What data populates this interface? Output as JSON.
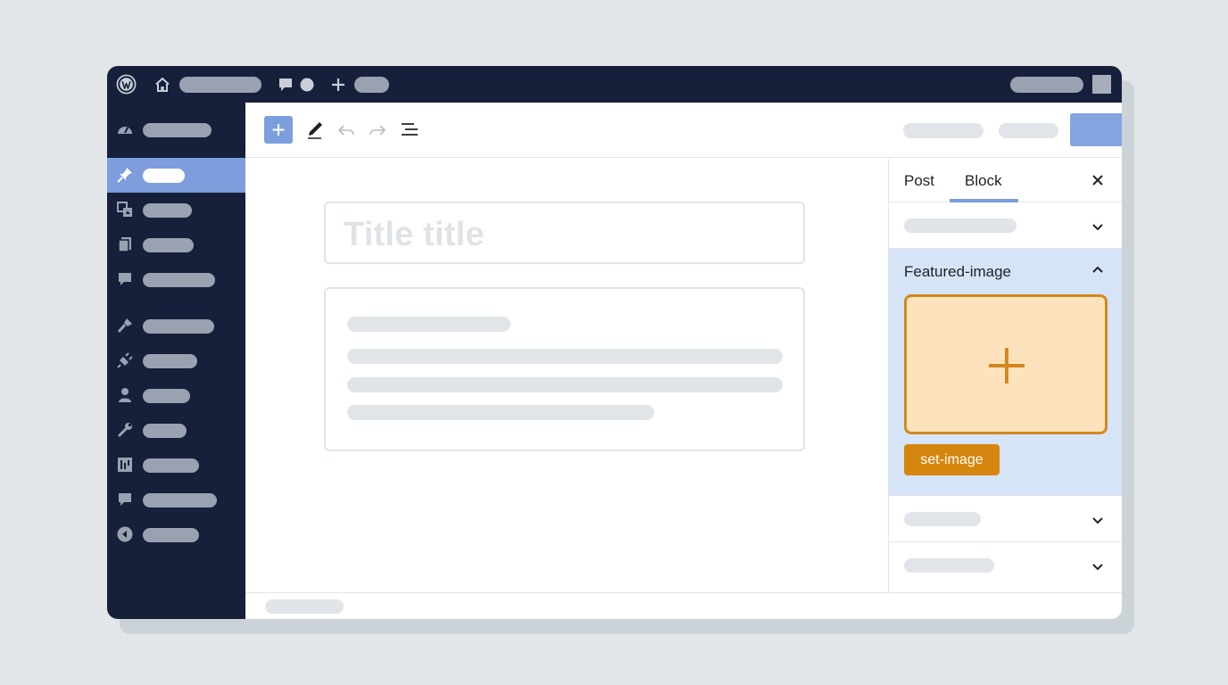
{
  "admin_bar": {
    "icons": [
      "wordpress-logo-icon",
      "home-icon",
      "comment-icon",
      "notification-dot-icon",
      "plus-icon",
      "avatar"
    ]
  },
  "sidebar": {
    "items": [
      {
        "icon": "dashboard-icon",
        "active": false
      },
      {
        "icon": "pin-icon",
        "active": true
      },
      {
        "icon": "media-icon",
        "active": false
      },
      {
        "icon": "pages-icon",
        "active": false
      },
      {
        "icon": "comments-icon",
        "active": false
      },
      {
        "icon": "appearance-icon",
        "active": false
      },
      {
        "icon": "plugins-icon",
        "active": false
      },
      {
        "icon": "users-icon",
        "active": false
      },
      {
        "icon": "tools-icon",
        "active": false
      },
      {
        "icon": "settings-icon",
        "active": false
      },
      {
        "icon": "feedback-icon",
        "active": false
      },
      {
        "icon": "collapse-icon",
        "active": false
      }
    ]
  },
  "toolbar": {
    "icons": [
      "add-block-icon",
      "edit-pen-icon",
      "undo-icon",
      "redo-icon",
      "list-view-icon",
      "settings-gear-icon",
      "more-vertical-icon"
    ]
  },
  "editor": {
    "title_placeholder": "Title title"
  },
  "panel": {
    "tabs": [
      {
        "label": "Post",
        "active": false
      },
      {
        "label": "Block",
        "active": true
      }
    ],
    "featured_image": {
      "title": "Featured-image",
      "button_label": "set-image",
      "accent_color": "#d5860f"
    }
  },
  "colors": {
    "navy": "#16203b",
    "accent_blue": "#7b9edc",
    "featured_bg": "#d6e4f8",
    "orange": "#d5860f"
  }
}
